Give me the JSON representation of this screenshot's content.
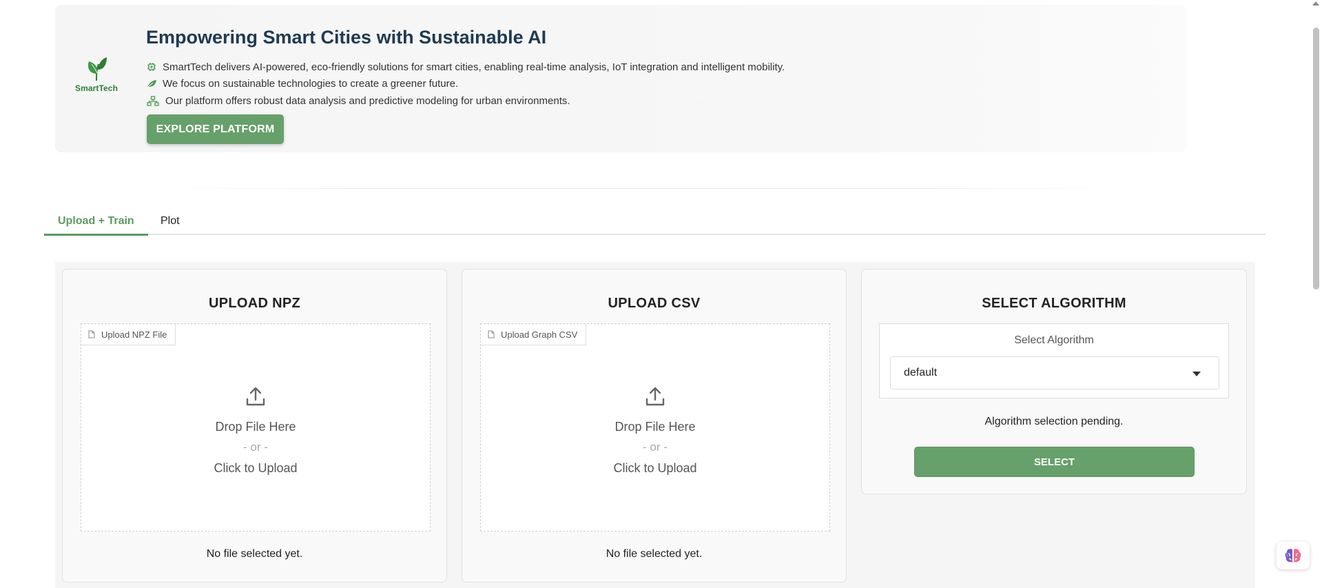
{
  "hero": {
    "logo_text": "SmartTech",
    "title": "Empowering Smart Cities with Sustainable AI",
    "lines": [
      {
        "icon": "chip-icon",
        "text": "SmartTech delivers AI-powered, eco-friendly solutions for smart cities, enabling real-time analysis, IoT integration and intelligent mobility."
      },
      {
        "icon": "leaf-icon",
        "text": "We focus on sustainable technologies to create a greener future."
      },
      {
        "icon": "network-icon",
        "text": "Our platform offers robust data analysis and predictive modeling for urban environments."
      }
    ],
    "button_label": "EXPLORE PLATFORM"
  },
  "tabs": [
    {
      "label": "Upload + Train",
      "active": true
    },
    {
      "label": "Plot",
      "active": false
    }
  ],
  "cards": {
    "npz": {
      "title": "UPLOAD NPZ",
      "dropzone_label": "Upload NPZ File",
      "drop_text": "Drop File Here",
      "or_text": "- or -",
      "click_text": "Click to Upload",
      "status": "No file selected yet."
    },
    "csv": {
      "title": "UPLOAD CSV",
      "dropzone_label": "Upload Graph CSV",
      "drop_text": "Drop File Here",
      "or_text": "- or -",
      "click_text": "Click to Upload",
      "status": "No file selected yet."
    },
    "algo": {
      "title": "SELECT ALGORITHM",
      "field_label": "Select Algorithm",
      "selected_value": "default",
      "status": "Algorithm selection pending.",
      "button_label": "SELECT"
    }
  },
  "colors": {
    "accent_green": "#66a06a",
    "tab_active": "#5b9a5f",
    "title_navy": "#1e3a52",
    "logo_green": "#2e7d32"
  }
}
